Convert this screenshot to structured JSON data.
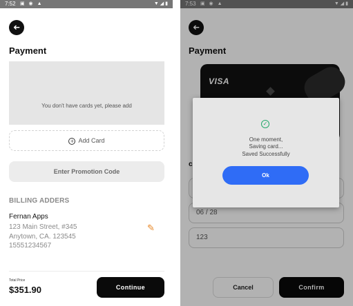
{
  "colors": {
    "accent_blue": "#2f6cf6",
    "primary_black": "#0a0a0a",
    "edit_orange": "#e8892a",
    "success_green": "#22a86a",
    "statusbar_gray": "#767676"
  },
  "left": {
    "status": {
      "time": "7:52",
      "icons": "▣ ◉ ▲",
      "right_icons": "▼◢▮"
    },
    "back_icon": "➜",
    "title": "Payment",
    "empty_message": "You don't have cards yet, please add",
    "add_card": {
      "icon": "+",
      "label": "Add Card"
    },
    "promo_label": "Enter Promotion Code",
    "billing": {
      "heading": "BILLING ADDERS",
      "name": "Fernan Apps",
      "lines": [
        "123 Main Street, #345",
        "Anytown, CA. 123545",
        "15551234567"
      ],
      "edit_icon": "✎"
    },
    "total": {
      "label": "Total Price",
      "amount": "$351.90"
    },
    "continue_label": "Continue"
  },
  "right": {
    "status": {
      "time": "7:53",
      "icons": "▣ ◉ ▲",
      "right_icons": "▼◢▮"
    },
    "back_icon": "➜",
    "title": "Payment",
    "card_brand": "VISA",
    "cvv_letter": "c",
    "fields": [
      "",
      "06 / 28",
      "123"
    ],
    "cancel_label": "Cancel",
    "confirm_label": "Confirm",
    "dialog": {
      "check_icon": "✓",
      "line1": "One moment,",
      "line2": "Saving card...",
      "line3": "Saved Successfully",
      "ok_label": "Ok"
    }
  }
}
